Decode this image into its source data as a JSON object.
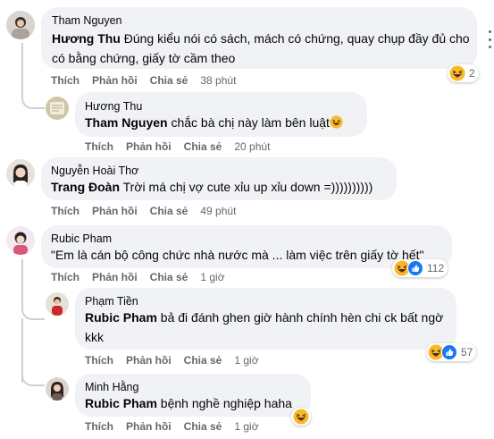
{
  "actions": {
    "like": "Thích",
    "reply": "Phản hồi",
    "share": "Chia sẻ"
  },
  "comments": [
    {
      "author": "Tham Nguyen",
      "mention": "Hương Thu",
      "text": " Đúng kiểu nói có sách, mách có chứng, quay chụp đầy đủ cho có bằng chứng, giấy tờ cầm theo",
      "time": "38 phút",
      "reaction_count": "2",
      "reaction_icons": [
        "haha-icon"
      ]
    },
    {
      "author": "Hương Thu",
      "mention": "Tham Nguyen",
      "text": " chắc bà chị này làm bên luật",
      "time": "20 phút"
    },
    {
      "author": "Nguyễn Hoài Thơ",
      "mention": "Trang Đoàn",
      "text": " Trời má chị vợ cute xỉu up xỉu down =))))))))))",
      "time": "49 phút"
    },
    {
      "author": "Rubic Pham",
      "text": "\"Em là cán bộ công chức nhà nước mà ... làm việc trên giấy tờ hết\"",
      "time": "1 giờ",
      "reaction_count": "112",
      "reaction_icons": [
        "haha-icon",
        "like-icon"
      ]
    },
    {
      "author": "Phạm Tiền",
      "mention": "Rubic Pham",
      "text": " bả đi đánh ghen giờ hành chính hèn chi ck bất ngờ kkk",
      "time": "1 giờ",
      "reaction_count": "57",
      "reaction_icons": [
        "haha-icon",
        "like-icon"
      ]
    },
    {
      "author": "Minh Hằng",
      "mention": "Rubic Pham",
      "text": " bệnh nghề nghiệp haha",
      "time": "1 giờ",
      "reaction_icons": [
        "haha-icon"
      ]
    }
  ],
  "colors": {
    "bubble": "#f0f2f5",
    "secondary_text": "#65676b",
    "like_blue": "#1877f2",
    "haha_yellow": "#f7b928"
  }
}
